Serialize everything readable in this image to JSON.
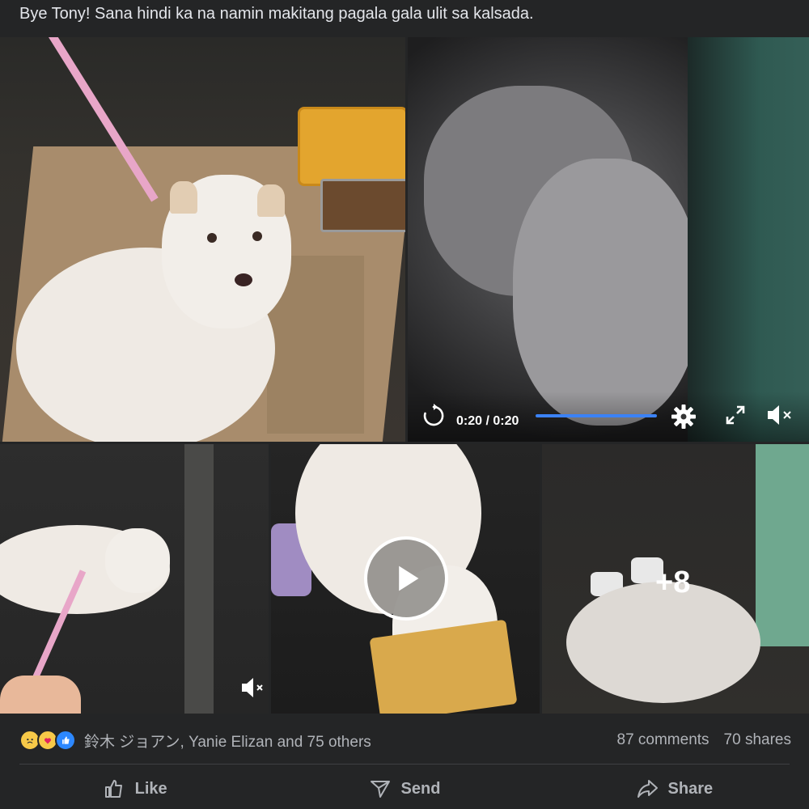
{
  "post": {
    "caption": "Bye Tony! Sana hindi ka na namin makitang pagala gala ulit sa kalsada."
  },
  "video": {
    "time": "0:20 / 0:20",
    "progress": 1.0
  },
  "media_grid": {
    "more_count": "+8"
  },
  "reactions": {
    "icons": [
      "sad-emoji-icon",
      "care-emoji-icon",
      "like-icon"
    ],
    "summary": "鈴木 ジョアン, Yanie Elizan and 75 others",
    "comments": "87 comments",
    "shares": "70 shares"
  },
  "actions": {
    "like": "Like",
    "send": "Send",
    "share": "Share"
  },
  "colors": {
    "background": "#242526",
    "text": "#e4e6eb",
    "muted": "#b0b3b8",
    "progress": "#3b82f6"
  }
}
